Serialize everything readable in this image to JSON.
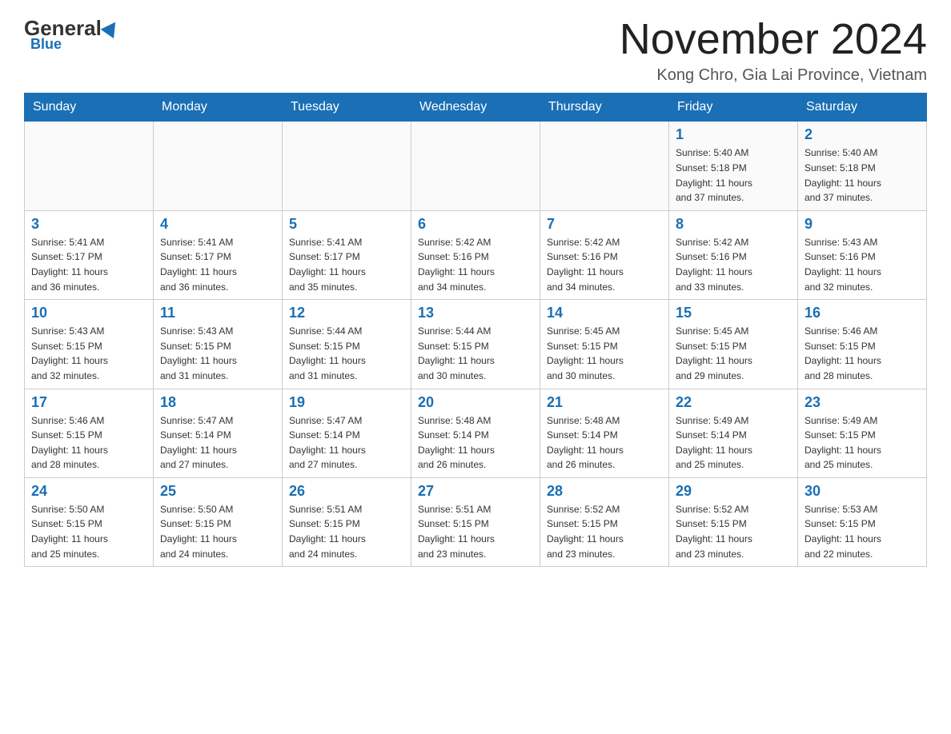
{
  "header": {
    "logo_general": "General",
    "logo_blue": "Blue",
    "month_title": "November 2024",
    "location": "Kong Chro, Gia Lai Province, Vietnam"
  },
  "days_of_week": [
    "Sunday",
    "Monday",
    "Tuesday",
    "Wednesday",
    "Thursday",
    "Friday",
    "Saturday"
  ],
  "weeks": [
    [
      {
        "day": "",
        "info": ""
      },
      {
        "day": "",
        "info": ""
      },
      {
        "day": "",
        "info": ""
      },
      {
        "day": "",
        "info": ""
      },
      {
        "day": "",
        "info": ""
      },
      {
        "day": "1",
        "info": "Sunrise: 5:40 AM\nSunset: 5:18 PM\nDaylight: 11 hours\nand 37 minutes."
      },
      {
        "day": "2",
        "info": "Sunrise: 5:40 AM\nSunset: 5:18 PM\nDaylight: 11 hours\nand 37 minutes."
      }
    ],
    [
      {
        "day": "3",
        "info": "Sunrise: 5:41 AM\nSunset: 5:17 PM\nDaylight: 11 hours\nand 36 minutes."
      },
      {
        "day": "4",
        "info": "Sunrise: 5:41 AM\nSunset: 5:17 PM\nDaylight: 11 hours\nand 36 minutes."
      },
      {
        "day": "5",
        "info": "Sunrise: 5:41 AM\nSunset: 5:17 PM\nDaylight: 11 hours\nand 35 minutes."
      },
      {
        "day": "6",
        "info": "Sunrise: 5:42 AM\nSunset: 5:16 PM\nDaylight: 11 hours\nand 34 minutes."
      },
      {
        "day": "7",
        "info": "Sunrise: 5:42 AM\nSunset: 5:16 PM\nDaylight: 11 hours\nand 34 minutes."
      },
      {
        "day": "8",
        "info": "Sunrise: 5:42 AM\nSunset: 5:16 PM\nDaylight: 11 hours\nand 33 minutes."
      },
      {
        "day": "9",
        "info": "Sunrise: 5:43 AM\nSunset: 5:16 PM\nDaylight: 11 hours\nand 32 minutes."
      }
    ],
    [
      {
        "day": "10",
        "info": "Sunrise: 5:43 AM\nSunset: 5:15 PM\nDaylight: 11 hours\nand 32 minutes."
      },
      {
        "day": "11",
        "info": "Sunrise: 5:43 AM\nSunset: 5:15 PM\nDaylight: 11 hours\nand 31 minutes."
      },
      {
        "day": "12",
        "info": "Sunrise: 5:44 AM\nSunset: 5:15 PM\nDaylight: 11 hours\nand 31 minutes."
      },
      {
        "day": "13",
        "info": "Sunrise: 5:44 AM\nSunset: 5:15 PM\nDaylight: 11 hours\nand 30 minutes."
      },
      {
        "day": "14",
        "info": "Sunrise: 5:45 AM\nSunset: 5:15 PM\nDaylight: 11 hours\nand 30 minutes."
      },
      {
        "day": "15",
        "info": "Sunrise: 5:45 AM\nSunset: 5:15 PM\nDaylight: 11 hours\nand 29 minutes."
      },
      {
        "day": "16",
        "info": "Sunrise: 5:46 AM\nSunset: 5:15 PM\nDaylight: 11 hours\nand 28 minutes."
      }
    ],
    [
      {
        "day": "17",
        "info": "Sunrise: 5:46 AM\nSunset: 5:15 PM\nDaylight: 11 hours\nand 28 minutes."
      },
      {
        "day": "18",
        "info": "Sunrise: 5:47 AM\nSunset: 5:14 PM\nDaylight: 11 hours\nand 27 minutes."
      },
      {
        "day": "19",
        "info": "Sunrise: 5:47 AM\nSunset: 5:14 PM\nDaylight: 11 hours\nand 27 minutes."
      },
      {
        "day": "20",
        "info": "Sunrise: 5:48 AM\nSunset: 5:14 PM\nDaylight: 11 hours\nand 26 minutes."
      },
      {
        "day": "21",
        "info": "Sunrise: 5:48 AM\nSunset: 5:14 PM\nDaylight: 11 hours\nand 26 minutes."
      },
      {
        "day": "22",
        "info": "Sunrise: 5:49 AM\nSunset: 5:14 PM\nDaylight: 11 hours\nand 25 minutes."
      },
      {
        "day": "23",
        "info": "Sunrise: 5:49 AM\nSunset: 5:15 PM\nDaylight: 11 hours\nand 25 minutes."
      }
    ],
    [
      {
        "day": "24",
        "info": "Sunrise: 5:50 AM\nSunset: 5:15 PM\nDaylight: 11 hours\nand 25 minutes."
      },
      {
        "day": "25",
        "info": "Sunrise: 5:50 AM\nSunset: 5:15 PM\nDaylight: 11 hours\nand 24 minutes."
      },
      {
        "day": "26",
        "info": "Sunrise: 5:51 AM\nSunset: 5:15 PM\nDaylight: 11 hours\nand 24 minutes."
      },
      {
        "day": "27",
        "info": "Sunrise: 5:51 AM\nSunset: 5:15 PM\nDaylight: 11 hours\nand 23 minutes."
      },
      {
        "day": "28",
        "info": "Sunrise: 5:52 AM\nSunset: 5:15 PM\nDaylight: 11 hours\nand 23 minutes."
      },
      {
        "day": "29",
        "info": "Sunrise: 5:52 AM\nSunset: 5:15 PM\nDaylight: 11 hours\nand 23 minutes."
      },
      {
        "day": "30",
        "info": "Sunrise: 5:53 AM\nSunset: 5:15 PM\nDaylight: 11 hours\nand 22 minutes."
      }
    ]
  ]
}
